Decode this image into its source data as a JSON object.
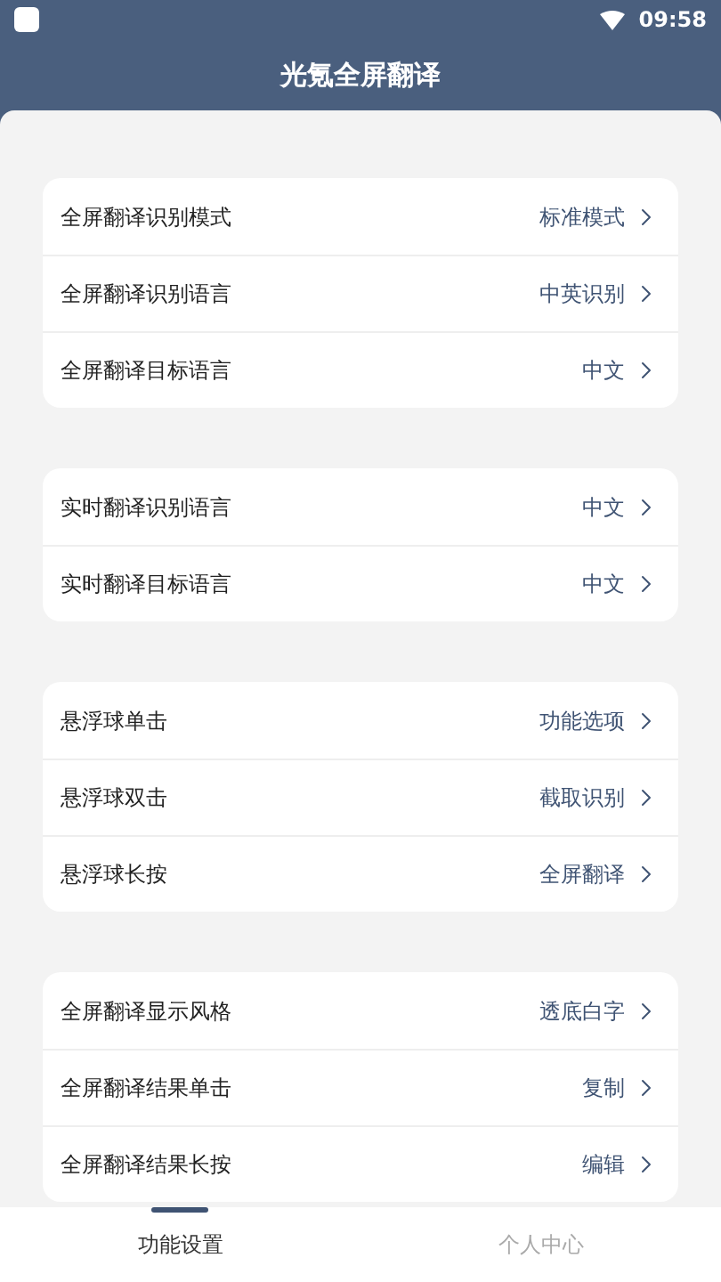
{
  "status_bar": {
    "time": "09:58"
  },
  "header": {
    "title": "光氪全屏翻译"
  },
  "groups": [
    {
      "items": [
        {
          "label": "全屏翻译识别模式",
          "value": "标准模式"
        },
        {
          "label": "全屏翻译识别语言",
          "value": "中英识别"
        },
        {
          "label": "全屏翻译目标语言",
          "value": "中文"
        }
      ]
    },
    {
      "items": [
        {
          "label": "实时翻译识别语言",
          "value": "中文"
        },
        {
          "label": "实时翻译目标语言",
          "value": "中文"
        }
      ]
    },
    {
      "items": [
        {
          "label": "悬浮球单击",
          "value": "功能选项"
        },
        {
          "label": "悬浮球双击",
          "value": "截取识别"
        },
        {
          "label": "悬浮球长按",
          "value": "全屏翻译"
        }
      ]
    },
    {
      "items": [
        {
          "label": "全屏翻译显示风格",
          "value": "透底白字"
        },
        {
          "label": "全屏翻译结果单击",
          "value": "复制"
        },
        {
          "label": "全屏翻译结果长按",
          "value": "编辑"
        }
      ]
    }
  ],
  "bottom_nav": [
    {
      "label": "功能设置",
      "selected": true
    },
    {
      "label": "个人中心",
      "selected": false
    }
  ]
}
